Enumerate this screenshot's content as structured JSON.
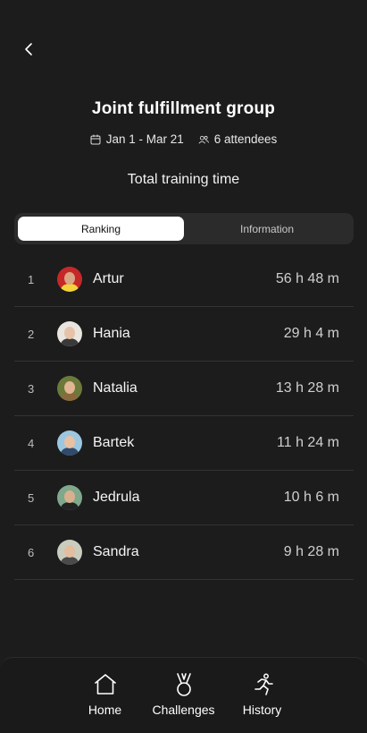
{
  "header": {
    "title": "Joint fulfillment group",
    "date_range": "Jan 1 - Mar 21",
    "attendees": "6 attendees",
    "metric": "Total training time"
  },
  "tabs": [
    {
      "label": "Ranking",
      "active": true
    },
    {
      "label": "Information",
      "active": false
    }
  ],
  "ranking": [
    {
      "rank": "1",
      "name": "Artur",
      "time": "56 h 48 m"
    },
    {
      "rank": "2",
      "name": "Hania",
      "time": "29 h 4 m"
    },
    {
      "rank": "3",
      "name": "Natalia",
      "time": "13 h 28 m"
    },
    {
      "rank": "4",
      "name": "Bartek",
      "time": "11 h 24 m"
    },
    {
      "rank": "5",
      "name": "Jedrula",
      "time": "10 h 6 m"
    },
    {
      "rank": "6",
      "name": "Sandra",
      "time": "9 h 28 m"
    }
  ],
  "nav": [
    {
      "label": "Home",
      "icon": "home-icon"
    },
    {
      "label": "Challenges",
      "icon": "medal-icon"
    },
    {
      "label": "History",
      "icon": "running-icon"
    }
  ],
  "colors": {
    "background": "#1c1c1c",
    "segment_bg": "#2b2b2b",
    "segment_active": "#ffffff",
    "divider": "#333333"
  }
}
